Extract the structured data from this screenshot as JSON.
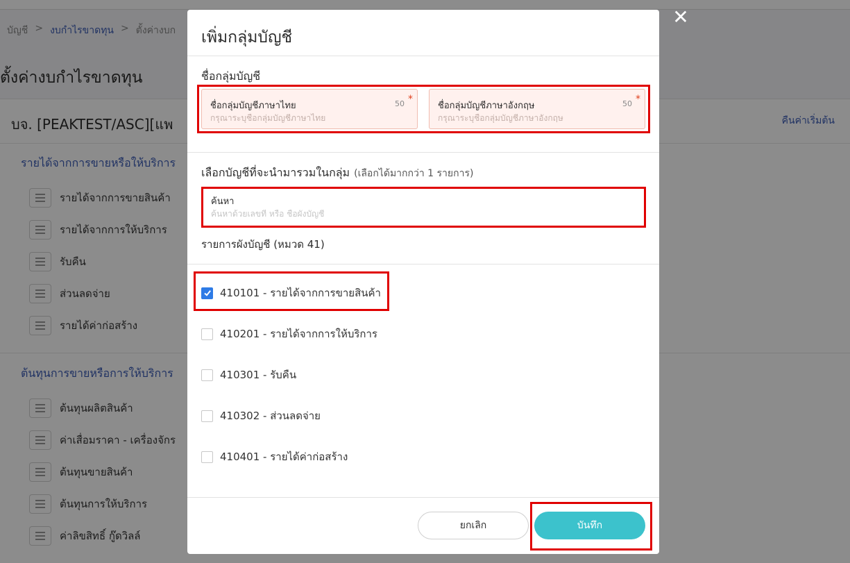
{
  "background": {
    "breadcrumb": [
      "บัญชี",
      ">",
      "งบกำไรขาดทุน",
      ">",
      "ตั้งค่างบก"
    ],
    "page_title": "ตั้งค่างบกำไรขาดทุน",
    "company_name": "บจ. [PEAKTEST/ASC][แพ",
    "reset_label": "คืนค่าเริ่มต้น",
    "sections": [
      {
        "title": "รายได้จากการขายหรือให้บริการ",
        "items": [
          "รายได้จากการขายสินค้า",
          "รายได้จากการให้บริการ",
          "รับคืน",
          "ส่วนลดจ่าย",
          "รายได้ค่าก่อสร้าง"
        ]
      },
      {
        "title": "ต้นทุนการขายหรือการให้บริการ",
        "items": [
          "ต้นทุนผลิตสินค้า",
          "ค่าเสื่อมราคา - เครื่องจักร",
          "ต้นทุนขายสินค้า",
          "ต้นทุนการให้บริการ",
          "ค่าลิขสิทธิ์ กู๊ดวิลล์"
        ]
      }
    ]
  },
  "modal": {
    "title": "เพิ่มกลุ่มบัญชี",
    "close_icon": "✕",
    "group_name_label": "ชื่อกลุ่มบัญชี",
    "thai_field": {
      "label": "ชื่อกลุ่มบัญชีภาษาไทย",
      "count": "50",
      "required_mark": "*",
      "placeholder": "กรุณาระบุชื่อกลุ่มบัญชีภาษาไทย",
      "value": ""
    },
    "english_field": {
      "label": "ชื่อกลุ่มบัญชีภาษาอังกฤษ",
      "count": "50",
      "required_mark": "*",
      "placeholder": "กรุณาระบุชื่อกลุ่มบัญชีภาษาอังกฤษ",
      "value": ""
    },
    "select_label": "เลือกบัญชีที่จะนำมารวมในกลุ่ม",
    "select_hint": "(เลือกได้มากกว่า 1 รายการ)",
    "search": {
      "label": "ค้นหา",
      "placeholder": "ค้นหาด้วยเลขที่ หรือ ชื่อผังบัญชี",
      "value": ""
    },
    "list_label": "รายการผังบัญชี (หมวด 41)",
    "accounts": [
      {
        "label": "410101 - รายได้จากการขายสินค้า",
        "checked": true
      },
      {
        "label": "410201 - รายได้จากการให้บริการ",
        "checked": false
      },
      {
        "label": "410301 - รับคืน",
        "checked": false
      },
      {
        "label": "410302 - ส่วนลดจ่าย",
        "checked": false
      },
      {
        "label": "410401 - รายได้ค่าก่อสร้าง",
        "checked": false
      }
    ],
    "cancel_label": "ยกเลิก",
    "save_label": "บันทึก"
  },
  "colors": {
    "accent_blue": "#3b5bb5",
    "save_button": "#3cc2cc",
    "checkbox_checked": "#2e7be6",
    "highlight_frame": "#e00000",
    "field_bg": "#fff1ee"
  }
}
